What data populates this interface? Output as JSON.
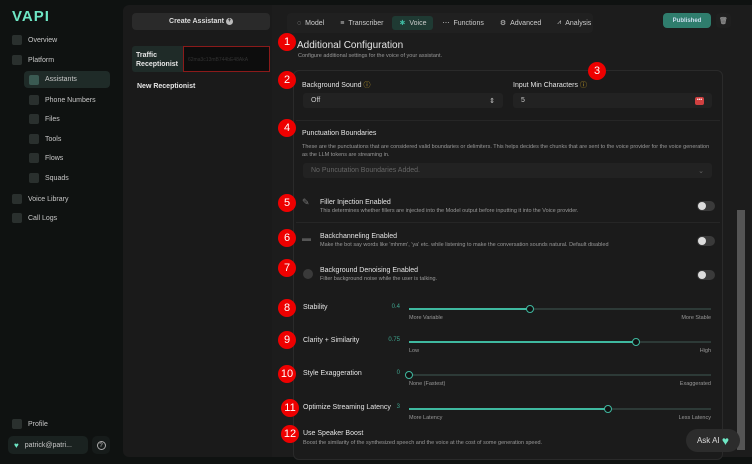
{
  "sidebar": {
    "logo": "VAPI",
    "items": [
      "Overview",
      "Platform",
      "Assistants",
      "Phone Numbers",
      "Files",
      "Tools",
      "Flows",
      "Squads",
      "Voice Library",
      "Call Logs"
    ],
    "profile": "Profile",
    "user": "patrick@patri..."
  },
  "assistants": {
    "create_label": "Create Assistant",
    "items": [
      {
        "name": "Traffic Receptionist",
        "id": "62ma3c13mB744bE48AkA"
      },
      {
        "name": "New Receptionist"
      }
    ]
  },
  "tabs": [
    "Model",
    "Transcriber",
    "Voice",
    "Functions",
    "Advanced",
    "Analysis"
  ],
  "published_label": "Published",
  "badges": [
    "1",
    "2",
    "3",
    "4",
    "5",
    "6",
    "7",
    "8",
    "9",
    "10",
    "11",
    "12"
  ],
  "section": {
    "title": "Additional Configuration",
    "subtitle": "Configure additional settings for the voice of your assistant."
  },
  "background_sound": {
    "label": "Background Sound",
    "value": "Off"
  },
  "input_min": {
    "label": "Input Min Characters",
    "value": "5"
  },
  "punctuation": {
    "label": "Punctuation Boundaries",
    "desc": "These are the punctuations that are considered valid boundaries or delimiters. This helps decides the chunks that are sent to the voice provider for the voice generation as the LLM tokens are streaming in.",
    "placeholder": "No Puncutation Boundaries Added."
  },
  "toggles": [
    {
      "title": "Filler Injection Enabled",
      "desc": "This determines whether fillers are injected into the Model output before inputting it into the Voice provider.",
      "on": false
    },
    {
      "title": "Backchanneling Enabled",
      "desc": "Make the bot say words like 'mhmm', 'ya' etc. while listening to make the conversation sounds natural. Default disabled",
      "on": false
    },
    {
      "title": "Background Denoising Enabled",
      "desc": "Filter background noise while the user is talking.",
      "on": false
    }
  ],
  "sliders": [
    {
      "label": "Stability",
      "value": "0.4",
      "fraction": 0.4,
      "min_label": "More Variable",
      "max_label": "More Stable"
    },
    {
      "label": "Clarity + Similarity",
      "value": "0.75",
      "fraction": 0.75,
      "min_label": "Low",
      "max_label": "High"
    },
    {
      "label": "Style Exaggeration",
      "value": "0",
      "fraction": 0,
      "min_label": "None (Fastest)",
      "max_label": "Exaggerated"
    },
    {
      "label": "Optimize Streaming Latency",
      "value": "3",
      "fraction": 0.66,
      "min_label": "More Latency",
      "max_label": "Less Latency"
    }
  ],
  "speaker_boost": {
    "title": "Use Speaker Boost",
    "desc": "Boost the similarity of the synthesized speech and the voice at the cost of some generation speed."
  },
  "ask_ai": "Ask AI"
}
